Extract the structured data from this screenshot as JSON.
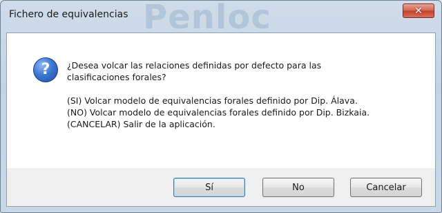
{
  "window": {
    "title": "Fichero de equivalencias",
    "background_brand_text": "Penloc"
  },
  "dialog": {
    "question_line1": "¿Desea volcar las relaciones definidas por defecto para las",
    "question_line2": "clasificaciones forales?",
    "option_yes": "(SI) Volcar modelo de equivalencias forales definido por Dip. Álava.",
    "option_no": "(NO) Volcar modelo de equivalencias forales definido por Dip. Bizkaia.",
    "option_cancel": "(CANCELAR) Salir de la aplicación."
  },
  "buttons": {
    "yes": "Sí",
    "no": "No",
    "cancel": "Cancelar"
  },
  "icons": {
    "message_icon": "question-icon",
    "close_icon": "close-icon"
  },
  "colors": {
    "close_button": "#c2412a",
    "question_icon": "#3b78d6"
  }
}
